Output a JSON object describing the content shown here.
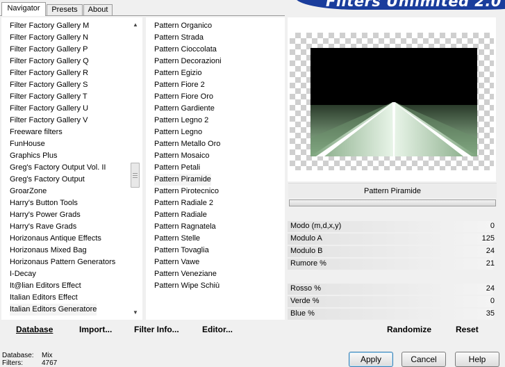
{
  "tabs": [
    {
      "label": "Navigator",
      "active": true
    },
    {
      "label": "Presets",
      "active": false
    },
    {
      "label": "About",
      "active": false
    }
  ],
  "banner": {
    "text": "Filters Unlimited 2.0",
    "color": "#1a3d9c"
  },
  "categories": {
    "items": [
      "Filter Factory Gallery M",
      "Filter Factory Gallery N",
      "Filter Factory Gallery P",
      "Filter Factory Gallery Q",
      "Filter Factory Gallery R",
      "Filter Factory Gallery S",
      "Filter Factory Gallery T",
      "Filter Factory Gallery U",
      "Filter Factory Gallery V",
      "Freeware filters",
      "FunHouse",
      "Graphics Plus",
      "Greg's Factory Output Vol. II",
      "Greg's Factory Output",
      "GroarZone",
      "Harry's Button Tools",
      "Harry's Power Grads",
      "Harry's Rave Grads",
      "Horizonaus Antique Effects",
      "Horizonaus Mixed Bag",
      "Horizonaus Pattern Generators",
      "I-Decay",
      "It@lian Editors Effect",
      "Italian Editors Effect",
      "Italian Editors Generatore"
    ],
    "selected_index": 24
  },
  "filters": {
    "items": [
      "Pattern  Organico",
      "Pattern  Strada",
      "Pattern Cioccolata",
      "Pattern Decorazioni",
      "Pattern Egizio",
      "Pattern Fiore 2",
      "Pattern Fiore Oro",
      "Pattern Gardiente",
      "Pattern Legno 2",
      "Pattern Legno",
      "Pattern Metallo Oro",
      "Pattern Mosaico",
      "Pattern Petali",
      "Pattern Piramide",
      "Pattern Pirotecnico",
      "Pattern Radiale 2",
      "Pattern Radiale",
      "Pattern Ragnatela",
      "Pattern Stelle",
      "Pattern Tovaglia",
      "Pattern Vawe",
      "Pattern Veneziane",
      "Pattern Wipe Schiù"
    ],
    "selected_index": 13
  },
  "preview": {
    "filter_name": "Pattern Piramide"
  },
  "parameters": [
    {
      "label": "Modo (m,d,x,y)",
      "value": "0"
    },
    {
      "label": "Modulo A",
      "value": "125"
    },
    {
      "label": "Modulo B",
      "value": "24"
    },
    {
      "label": "Rumore %",
      "value": "21"
    },
    {
      "label": "Rosso %",
      "value": "24"
    },
    {
      "label": "Verde %",
      "value": "0"
    },
    {
      "label": "Blue %",
      "value": "35"
    }
  ],
  "commands": {
    "database": "Database",
    "import": "Import...",
    "filter_info": "Filter Info...",
    "editor": "Editor...",
    "randomize": "Randomize",
    "reset": "Reset"
  },
  "status": {
    "database_label": "Database:",
    "database_value": "Mix",
    "filters_label": "Filters:",
    "filters_value": "4767"
  },
  "buttons": {
    "apply": "Apply",
    "cancel": "Cancel",
    "help": "Help"
  }
}
